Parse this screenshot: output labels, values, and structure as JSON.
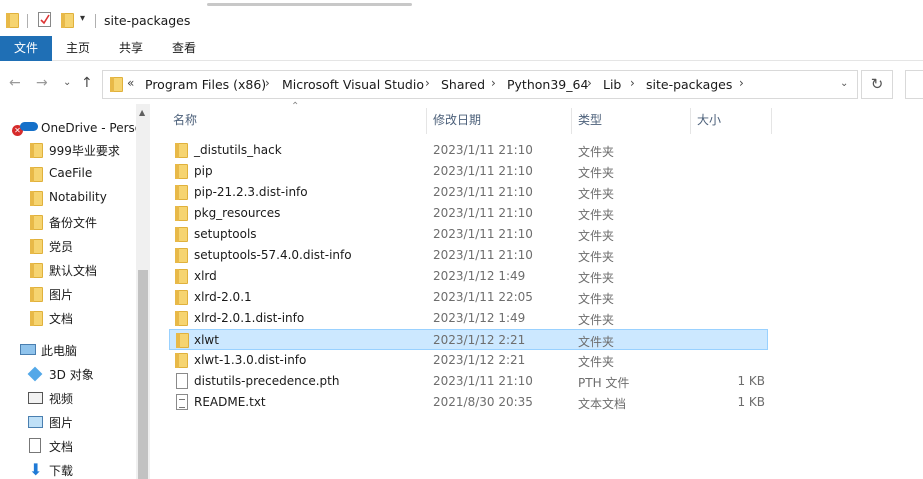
{
  "window": {
    "title": "site-packages"
  },
  "ribbon": {
    "tabs": [
      "文件",
      "主页",
      "共享",
      "查看"
    ]
  },
  "address": {
    "overflow": "«",
    "crumbs": [
      "Program Files (x86)",
      "Microsoft Visual Studio",
      "Shared",
      "Python39_64",
      "Lib",
      "site-packages"
    ]
  },
  "sidebar": {
    "onedrive": "OneDrive - Perso",
    "quick": [
      "999毕业要求",
      "CaeFile",
      "Notability",
      "备份文件",
      "党员",
      "默认文档",
      "图片",
      "文档"
    ],
    "thispc": "此电脑",
    "pc_items": [
      "3D 对象",
      "视频",
      "图片",
      "文档",
      "下载"
    ]
  },
  "columns": {
    "name": "名称",
    "date": "修改日期",
    "type": "类型",
    "size": "大小"
  },
  "files": [
    {
      "name": "_distutils_hack",
      "date": "2023/1/11 21:10",
      "type": "文件夹",
      "size": "",
      "kind": "folder"
    },
    {
      "name": "pip",
      "date": "2023/1/11 21:10",
      "type": "文件夹",
      "size": "",
      "kind": "folder"
    },
    {
      "name": "pip-21.2.3.dist-info",
      "date": "2023/1/11 21:10",
      "type": "文件夹",
      "size": "",
      "kind": "folder"
    },
    {
      "name": "pkg_resources",
      "date": "2023/1/11 21:10",
      "type": "文件夹",
      "size": "",
      "kind": "folder"
    },
    {
      "name": "setuptools",
      "date": "2023/1/11 21:10",
      "type": "文件夹",
      "size": "",
      "kind": "folder"
    },
    {
      "name": "setuptools-57.4.0.dist-info",
      "date": "2023/1/11 21:10",
      "type": "文件夹",
      "size": "",
      "kind": "folder"
    },
    {
      "name": "xlrd",
      "date": "2023/1/12 1:49",
      "type": "文件夹",
      "size": "",
      "kind": "folder"
    },
    {
      "name": "xlrd-2.0.1",
      "date": "2023/1/11 22:05",
      "type": "文件夹",
      "size": "",
      "kind": "folder"
    },
    {
      "name": "xlrd-2.0.1.dist-info",
      "date": "2023/1/12 1:49",
      "type": "文件夹",
      "size": "",
      "kind": "folder"
    },
    {
      "name": "xlwt",
      "date": "2023/1/12 2:21",
      "type": "文件夹",
      "size": "",
      "kind": "folder",
      "selected": true
    },
    {
      "name": "xlwt-1.3.0.dist-info",
      "date": "2023/1/12 2:21",
      "type": "文件夹",
      "size": "",
      "kind": "folder"
    },
    {
      "name": "distutils-precedence.pth",
      "date": "2023/1/11 21:10",
      "type": "PTH 文件",
      "size": "1 KB",
      "kind": "file"
    },
    {
      "name": "README.txt",
      "date": "2021/8/30 20:35",
      "type": "文本文档",
      "size": "1 KB",
      "kind": "txt"
    }
  ],
  "colors": {
    "accent": "#1f6fb5",
    "selection": "#cce8ff",
    "folder": "#f6d470"
  }
}
